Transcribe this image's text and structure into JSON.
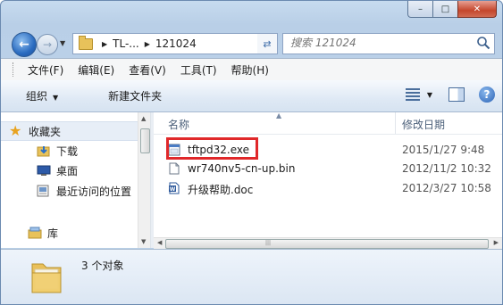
{
  "window": {
    "caption_buttons": [
      "–",
      "□",
      "✕"
    ]
  },
  "nav": {
    "breadcrumb": [
      "TL-...",
      "121024"
    ],
    "search_placeholder": "搜索 121024"
  },
  "menu": [
    "文件(F)",
    "编辑(E)",
    "查看(V)",
    "工具(T)",
    "帮助(H)"
  ],
  "commands": {
    "organize": "组织",
    "new_folder": "新建文件夹"
  },
  "sidebar": {
    "favorites_label": "收藏夹",
    "items": [
      "下载",
      "桌面",
      "最近访问的位置"
    ],
    "library_label": "库"
  },
  "columns": {
    "name": "名称",
    "date": "修改日期"
  },
  "files": [
    {
      "name": "tftpd32.exe",
      "date": "2015/1/27 9:48",
      "icon": "exe-icon"
    },
    {
      "name": "wr740nv5-cn-up.bin",
      "date": "2012/11/2 10:32",
      "icon": "bin-file-icon"
    },
    {
      "name": "升级帮助.doc",
      "date": "2012/3/27 10:58",
      "icon": "word-doc-icon"
    }
  ],
  "details": {
    "summary": "3 个对象"
  },
  "colors": {
    "highlight": "#e0282a",
    "window_frame": "#b9cfe7"
  }
}
